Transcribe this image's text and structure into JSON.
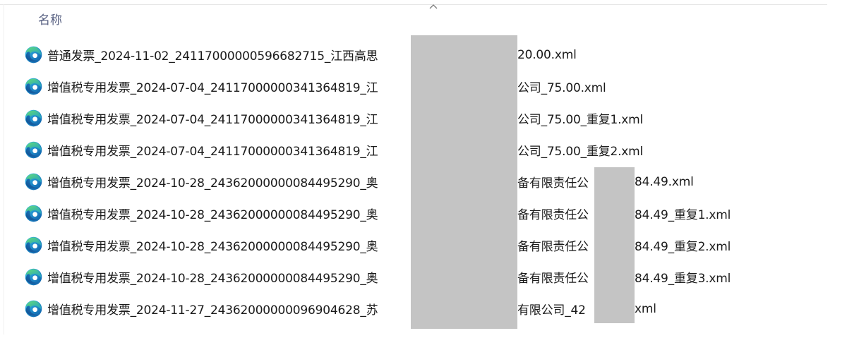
{
  "column_header": "名称",
  "files": [
    {
      "name": "普通发票_2024-11-02_24117000000596682715_江西高思",
      "tail": "20.00.xml"
    },
    {
      "name": "增值税专用发票_2024-07-04_24117000000341364819_江",
      "tail": "公司_75.00.xml"
    },
    {
      "name": "增值税专用发票_2024-07-04_24117000000341364819_江",
      "tail": "公司_75.00_重复1.xml"
    },
    {
      "name": "增值税专用发票_2024-07-04_24117000000341364819_江",
      "tail": "公司_75.00_重复2.xml"
    },
    {
      "name": "增值税专用发票_2024-10-28_24362000000084495290_奥",
      "tail": "备有限责任公",
      "tail2": "84.49.xml"
    },
    {
      "name": "增值税专用发票_2024-10-28_24362000000084495290_奥",
      "tail": "备有限责任公",
      "tail2": "84.49_重复1.xml"
    },
    {
      "name": "增值税专用发票_2024-10-28_24362000000084495290_奥",
      "tail": "备有限责任公",
      "tail2": "84.49_重复2.xml"
    },
    {
      "name": "增值税专用发票_2024-10-28_24362000000084495290_奥",
      "tail": "备有限责任公",
      "tail2": "84.49_重复3.xml"
    },
    {
      "name": "增值税专用发票_2024-11-27_24362000000096904628_苏",
      "tail": "有限公司_42",
      "tail2": "xml"
    }
  ],
  "icons": {
    "file_icon": "edge-browser-icon",
    "sort": "chevron-up-icon"
  },
  "colors": {
    "header_text": "#555e80",
    "redaction": "#c4c4c4"
  }
}
